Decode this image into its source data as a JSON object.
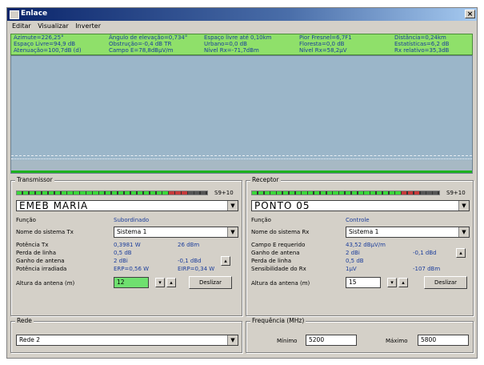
{
  "window": {
    "title": "Enlace",
    "close_glyph": "×"
  },
  "menu": [
    "Editar",
    "Visualizar",
    "Inverter"
  ],
  "info": {
    "col1": [
      "Azimute=226,25°",
      "Espaço Livre=94,9 dB",
      "Atenuação=100,7dB (d)"
    ],
    "col2": [
      "Ângulo de elevação=0,734°",
      "Obstrução=-0,4 dB TR",
      "Campo E=78,8dBµV/m"
    ],
    "col3": [
      "Espaço livre até 0,10km",
      "Urbano=0,0 dB",
      "Nível Rx=-71,7dBm"
    ],
    "col4": [
      "Pior Fresnel=6,7F1",
      "Floresta=0,0 dB",
      "Nível Rx=58,2µV"
    ],
    "col5": [
      "Distância=0,24km",
      "Estatísticas=6,2 dB",
      "Rx relativo=35,3dB"
    ]
  },
  "transmissor": {
    "title": "Transmissor",
    "level": "S9+10",
    "level_fraction": 0.9,
    "station": "EMEB MARIA",
    "funcao_label": "Função",
    "funcao_value": "Subordinado",
    "sistema_label": "Nome do sistema Tx",
    "sistema_value": "Sistema 1",
    "potencia_label": "Potência Tx",
    "potencia_w": "0,3981 W",
    "potencia_dbm": "26 dBm",
    "perda_label": "Perda de linha",
    "perda_value": "0,5 dB",
    "ganho_label": "Ganho de antena",
    "ganho_dbi": "2 dBi",
    "ganho_dbd": "-0,1 dBd",
    "irradiada_label": "Potência irradiada",
    "erp": "ERP=0,56 W",
    "eirp": "EIRP=0,34 W",
    "altura_label": "Altura da antena (m)",
    "altura_value": "12",
    "deslizar": "Deslizar"
  },
  "receptor": {
    "title": "Receptor",
    "level": "S9+10",
    "level_fraction": 0.9,
    "station": "PONTO 05",
    "funcao_label": "Função",
    "funcao_value": "Controle",
    "sistema_label": "Nome do sistema Rx",
    "sistema_value": "Sistema 1",
    "campo_label": "Campo E requerido",
    "campo_value": "43,52 dBµV/m",
    "ganho_label": "Ganho de antena",
    "ganho_dbi": "2 dBi",
    "ganho_dbd": "-0,1 dBd",
    "perda_label": "Perda de linha",
    "perda_value": "0,5 dB",
    "sens_label": "Sensibilidade do Rx",
    "sens_uv": "1µV",
    "sens_dbm": "-107 dBm",
    "altura_label": "Altura da antena (m)",
    "altura_value": "15",
    "deslizar": "Deslizar"
  },
  "rede": {
    "title": "Rede",
    "value": "Rede 2"
  },
  "freq": {
    "title": "Frequência (MHz)",
    "min_label": "Mínimo",
    "min_value": "5200",
    "max_label": "Máximo",
    "max_value": "5800"
  },
  "icons": {
    "dropdown": "chevron-down-icon",
    "spin_down": "▾",
    "spin_up": "▴"
  }
}
